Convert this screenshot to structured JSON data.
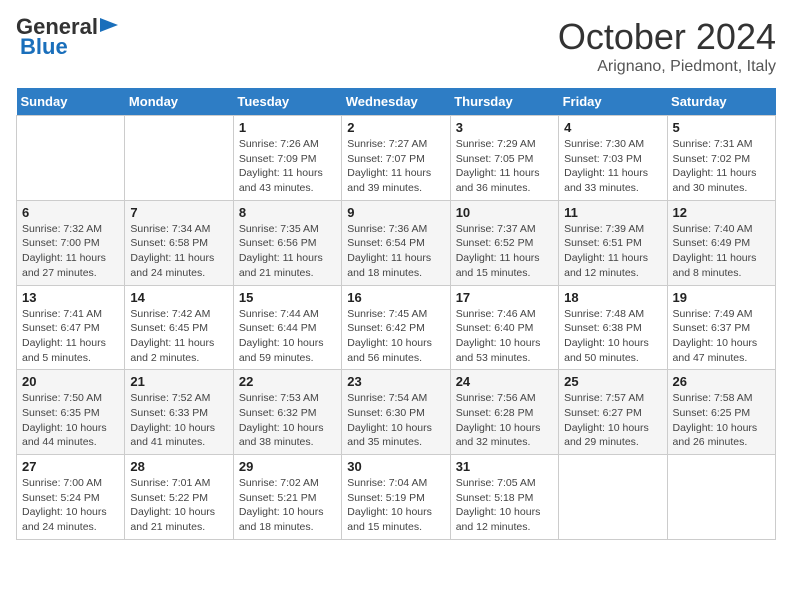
{
  "header": {
    "logo_line1": "General",
    "logo_line2": "Blue",
    "month": "October 2024",
    "location": "Arignano, Piedmont, Italy"
  },
  "weekdays": [
    "Sunday",
    "Monday",
    "Tuesday",
    "Wednesday",
    "Thursday",
    "Friday",
    "Saturday"
  ],
  "weeks": [
    [
      {
        "day": "",
        "info": ""
      },
      {
        "day": "",
        "info": ""
      },
      {
        "day": "1",
        "info": "Sunrise: 7:26 AM\nSunset: 7:09 PM\nDaylight: 11 hours and 43 minutes."
      },
      {
        "day": "2",
        "info": "Sunrise: 7:27 AM\nSunset: 7:07 PM\nDaylight: 11 hours and 39 minutes."
      },
      {
        "day": "3",
        "info": "Sunrise: 7:29 AM\nSunset: 7:05 PM\nDaylight: 11 hours and 36 minutes."
      },
      {
        "day": "4",
        "info": "Sunrise: 7:30 AM\nSunset: 7:03 PM\nDaylight: 11 hours and 33 minutes."
      },
      {
        "day": "5",
        "info": "Sunrise: 7:31 AM\nSunset: 7:02 PM\nDaylight: 11 hours and 30 minutes."
      }
    ],
    [
      {
        "day": "6",
        "info": "Sunrise: 7:32 AM\nSunset: 7:00 PM\nDaylight: 11 hours and 27 minutes."
      },
      {
        "day": "7",
        "info": "Sunrise: 7:34 AM\nSunset: 6:58 PM\nDaylight: 11 hours and 24 minutes."
      },
      {
        "day": "8",
        "info": "Sunrise: 7:35 AM\nSunset: 6:56 PM\nDaylight: 11 hours and 21 minutes."
      },
      {
        "day": "9",
        "info": "Sunrise: 7:36 AM\nSunset: 6:54 PM\nDaylight: 11 hours and 18 minutes."
      },
      {
        "day": "10",
        "info": "Sunrise: 7:37 AM\nSunset: 6:52 PM\nDaylight: 11 hours and 15 minutes."
      },
      {
        "day": "11",
        "info": "Sunrise: 7:39 AM\nSunset: 6:51 PM\nDaylight: 11 hours and 12 minutes."
      },
      {
        "day": "12",
        "info": "Sunrise: 7:40 AM\nSunset: 6:49 PM\nDaylight: 11 hours and 8 minutes."
      }
    ],
    [
      {
        "day": "13",
        "info": "Sunrise: 7:41 AM\nSunset: 6:47 PM\nDaylight: 11 hours and 5 minutes."
      },
      {
        "day": "14",
        "info": "Sunrise: 7:42 AM\nSunset: 6:45 PM\nDaylight: 11 hours and 2 minutes."
      },
      {
        "day": "15",
        "info": "Sunrise: 7:44 AM\nSunset: 6:44 PM\nDaylight: 10 hours and 59 minutes."
      },
      {
        "day": "16",
        "info": "Sunrise: 7:45 AM\nSunset: 6:42 PM\nDaylight: 10 hours and 56 minutes."
      },
      {
        "day": "17",
        "info": "Sunrise: 7:46 AM\nSunset: 6:40 PM\nDaylight: 10 hours and 53 minutes."
      },
      {
        "day": "18",
        "info": "Sunrise: 7:48 AM\nSunset: 6:38 PM\nDaylight: 10 hours and 50 minutes."
      },
      {
        "day": "19",
        "info": "Sunrise: 7:49 AM\nSunset: 6:37 PM\nDaylight: 10 hours and 47 minutes."
      }
    ],
    [
      {
        "day": "20",
        "info": "Sunrise: 7:50 AM\nSunset: 6:35 PM\nDaylight: 10 hours and 44 minutes."
      },
      {
        "day": "21",
        "info": "Sunrise: 7:52 AM\nSunset: 6:33 PM\nDaylight: 10 hours and 41 minutes."
      },
      {
        "day": "22",
        "info": "Sunrise: 7:53 AM\nSunset: 6:32 PM\nDaylight: 10 hours and 38 minutes."
      },
      {
        "day": "23",
        "info": "Sunrise: 7:54 AM\nSunset: 6:30 PM\nDaylight: 10 hours and 35 minutes."
      },
      {
        "day": "24",
        "info": "Sunrise: 7:56 AM\nSunset: 6:28 PM\nDaylight: 10 hours and 32 minutes."
      },
      {
        "day": "25",
        "info": "Sunrise: 7:57 AM\nSunset: 6:27 PM\nDaylight: 10 hours and 29 minutes."
      },
      {
        "day": "26",
        "info": "Sunrise: 7:58 AM\nSunset: 6:25 PM\nDaylight: 10 hours and 26 minutes."
      }
    ],
    [
      {
        "day": "27",
        "info": "Sunrise: 7:00 AM\nSunset: 5:24 PM\nDaylight: 10 hours and 24 minutes."
      },
      {
        "day": "28",
        "info": "Sunrise: 7:01 AM\nSunset: 5:22 PM\nDaylight: 10 hours and 21 minutes."
      },
      {
        "day": "29",
        "info": "Sunrise: 7:02 AM\nSunset: 5:21 PM\nDaylight: 10 hours and 18 minutes."
      },
      {
        "day": "30",
        "info": "Sunrise: 7:04 AM\nSunset: 5:19 PM\nDaylight: 10 hours and 15 minutes."
      },
      {
        "day": "31",
        "info": "Sunrise: 7:05 AM\nSunset: 5:18 PM\nDaylight: 10 hours and 12 minutes."
      },
      {
        "day": "",
        "info": ""
      },
      {
        "day": "",
        "info": ""
      }
    ]
  ]
}
